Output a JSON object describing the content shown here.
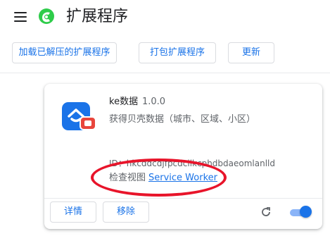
{
  "header": {
    "title": "扩展程序",
    "menu_icon": "hamburger-menu-icon",
    "logo_icon": "extensions-logo-icon"
  },
  "toolbar": {
    "load_unpacked_label": "加载已解压的扩展程序",
    "pack_label": "打包扩展程序",
    "update_label": "更新"
  },
  "extension": {
    "name": "ke数据",
    "version": "1.0.0",
    "description": "获得贝壳数据（城市、区域、小区）",
    "id_text": "ID：hkcddcdjfpcdcllkcphdbdaeomlanlld",
    "inspect_label": "检查视图",
    "inspect_link": "Service Worker",
    "details_label": "详情",
    "remove_label": "移除",
    "enabled": true
  },
  "colors": {
    "accent": "#1a73e8",
    "annotation": "#e8142a",
    "ext_icon_bg": "#1a73e8",
    "ext_badge": "#e8453c"
  }
}
